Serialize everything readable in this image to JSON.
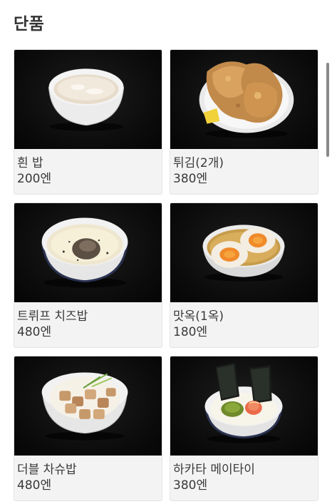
{
  "section": {
    "title": "단품"
  },
  "items": [
    {
      "name": "흰 밥",
      "price": "200엔"
    },
    {
      "name": "튀김(2개)",
      "price": "380엔"
    },
    {
      "name": "트뤼프 치즈밥",
      "price": "480엔"
    },
    {
      "name": "맛옥(1옥)",
      "price": "180엔"
    },
    {
      "name": "더블 차슈밥",
      "price": "480엔"
    },
    {
      "name": "하카타 메이타이",
      "price": "380엔"
    }
  ]
}
